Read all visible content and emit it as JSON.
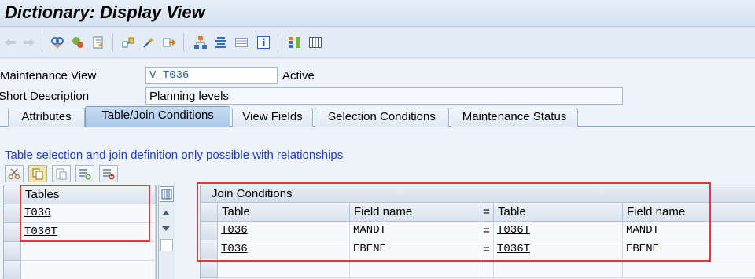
{
  "window": {
    "title": "Dictionary: Display View"
  },
  "toolbar": {
    "icons": [
      "back-arrow-icon",
      "forward-arrow-icon",
      "other-object-icon",
      "display-change-icon",
      "activate-icon",
      "where-used-icon",
      "object-list-icon",
      "hierarchy-icon",
      "navigation-window-icon",
      "display-object-list-icon",
      "info-icon",
      "table-view-icon",
      "column-icon"
    ]
  },
  "fields": {
    "maintenance_view_label": "Maintenance View",
    "maintenance_view_value": "V_T036",
    "status": "Active",
    "short_description_label": "Short Description",
    "short_description_value": "Planning levels"
  },
  "tabs": [
    {
      "label": "Attributes"
    },
    {
      "label": "Table/Join Conditions"
    },
    {
      "label": "View Fields"
    },
    {
      "label": "Selection Conditions"
    },
    {
      "label": "Maintenance Status"
    }
  ],
  "hint": "Table selection and join definition only possible with relationships",
  "tables": {
    "header": "Tables",
    "rows": [
      "T036",
      "T036T"
    ]
  },
  "join_conditions": {
    "title": "Join Conditions",
    "columns": [
      "Table",
      "Field name",
      "=",
      "Table",
      "Field name"
    ],
    "rows": [
      {
        "table1": "T036",
        "field1": "MANDT",
        "eq": "=",
        "table2": "T036T",
        "field2": "MANDT"
      },
      {
        "table1": "T036",
        "field1": "EBENE",
        "eq": "=",
        "table2": "T036T",
        "field2": "EBENE"
      }
    ]
  },
  "colors": {
    "highlight": "#e0393a",
    "hint_text": "#1f3fbf",
    "active_tab": "#a9c7e8"
  }
}
